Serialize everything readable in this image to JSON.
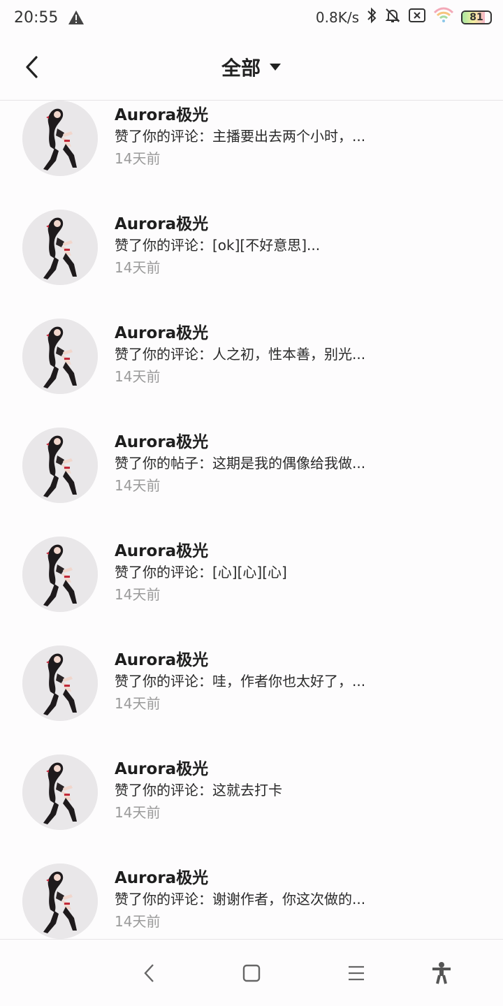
{
  "status_bar": {
    "time": "20:55",
    "net_speed": "0.8K/s",
    "battery": "81",
    "battery_level": 0.81
  },
  "header": {
    "title": "全部"
  },
  "notifications": [
    {
      "name": "Aurora极光",
      "message": "赞了你的评论：主播要出去两个小时，...",
      "time": "14天前"
    },
    {
      "name": "Aurora极光",
      "message": "赞了你的评论：[ok][不好意思]...",
      "time": "14天前"
    },
    {
      "name": "Aurora极光",
      "message": "赞了你的评论：人之初，性本善，别光...",
      "time": "14天前"
    },
    {
      "name": "Aurora极光",
      "message": "赞了你的帖子：这期是我的偶像给我做...",
      "time": "14天前"
    },
    {
      "name": "Aurora极光",
      "message": "赞了你的评论：[心][心][心]",
      "time": "14天前"
    },
    {
      "name": "Aurora极光",
      "message": "赞了你的评论：哇，作者你也太好了，...",
      "time": "14天前"
    },
    {
      "name": "Aurora极光",
      "message": "赞了你的评论：这就去打卡",
      "time": "14天前"
    },
    {
      "name": "Aurora极光",
      "message": "赞了你的评论：谢谢作者，你这次做的...",
      "time": "14天前"
    }
  ],
  "colors": {
    "background": "#fdfcfd",
    "avatar_bg": "#e8e6e8",
    "muted_text": "#9a9a9a"
  }
}
